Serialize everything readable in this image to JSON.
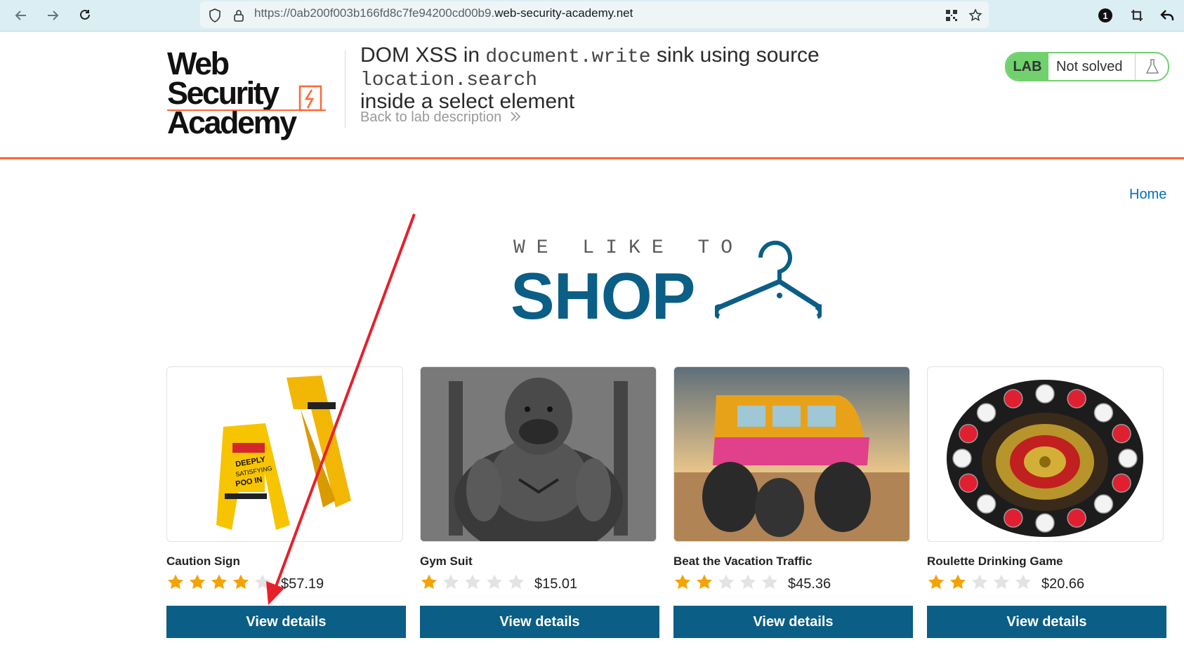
{
  "browser": {
    "url_prefix": "https://0ab200f003b166fd8c7fe94200cd00b9.",
    "url_domain": "web-security-academy.net",
    "notification_count": "1"
  },
  "header": {
    "logo_line1": "Web Security",
    "logo_line2": "Academy",
    "title_parts": [
      "DOM XSS in ",
      "document.write",
      " sink using source ",
      "location.search"
    ],
    "title_line2": "inside a select element",
    "back_link": "Back to lab description",
    "lab_badge": "LAB",
    "lab_state": "Not solved",
    "home_link": "Home"
  },
  "banner": {
    "small": "WE LIKE TO",
    "big": "SHOP"
  },
  "products": [
    {
      "name": "Caution Sign",
      "rating": 4,
      "price": "$57.19",
      "button": "View details"
    },
    {
      "name": "Gym Suit",
      "rating": 1,
      "price": "$15.01",
      "button": "View details"
    },
    {
      "name": "Beat the Vacation Traffic",
      "rating": 2,
      "price": "$45.36",
      "button": "View details"
    },
    {
      "name": "Roulette Drinking Game",
      "rating": 2,
      "price": "$20.66",
      "button": "View details"
    }
  ],
  "colors": {
    "brand_blue": "#0b5e86",
    "accent_orange": "#ff6633",
    "lab_green": "#70d16d",
    "star_gold": "#f5a300",
    "annotation_red": "#e8202a"
  }
}
